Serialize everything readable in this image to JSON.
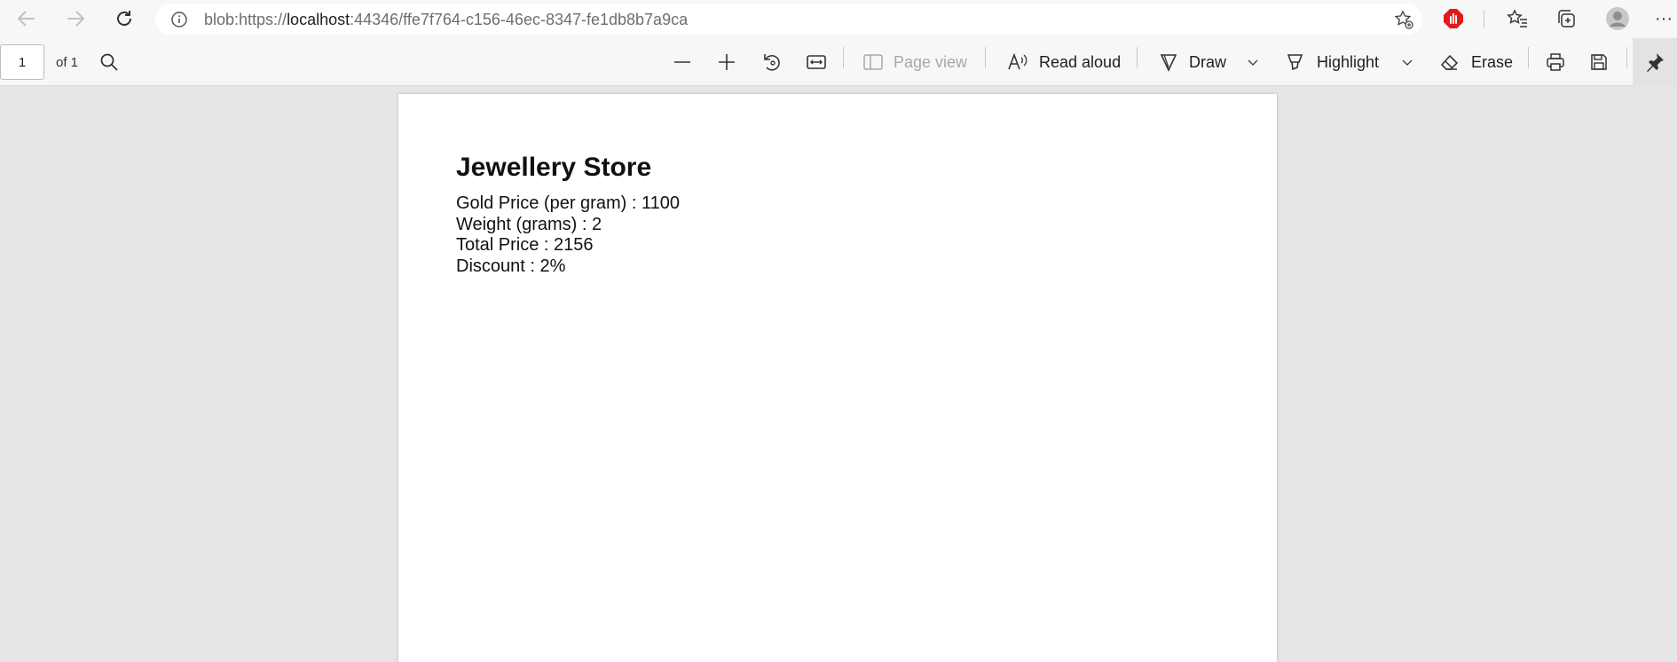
{
  "browser": {
    "url_prefix": "blob:https://",
    "url_host": "localhost",
    "url_rest": ":44346/ffe7f764-c156-46ec-8347-fe1db8b7a9ca",
    "more_label": "···"
  },
  "pdf_toolbar": {
    "page_number": "1",
    "page_count_label": "of 1",
    "page_view_label": "Page view",
    "read_aloud_label": "Read aloud",
    "draw_label": "Draw",
    "highlight_label": "Highlight",
    "erase_label": "Erase"
  },
  "document": {
    "title": "Jewellery Store",
    "lines": [
      "Gold Price (per gram) :  1100",
      "Weight (grams) :  2",
      "Total Price :  2156",
      "Discount :  2%"
    ]
  },
  "colors": {
    "adblock_red": "#e01b1b",
    "toolbar_bg": "#f7f7f7",
    "viewer_bg": "#e6e6e6"
  }
}
